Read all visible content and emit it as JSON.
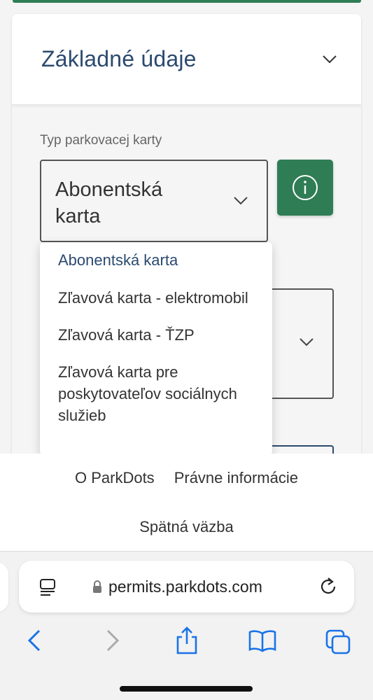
{
  "section": {
    "title": "Základné údaje"
  },
  "form": {
    "card_type_label": "Typ parkovacej karty",
    "card_type_value": "Abonentská karta"
  },
  "dropdown": {
    "options": [
      {
        "label": "Abonentská karta",
        "selected": true
      },
      {
        "label": "Zľavová karta - elektromobil",
        "selected": false
      },
      {
        "label": "Zľavová karta - ŤZP",
        "selected": false
      },
      {
        "label": "Zľavová karta pre poskytovateľov sociálnych služieb",
        "selected": false
      }
    ]
  },
  "footer": {
    "about": "O ParkDots",
    "legal": "Právne informácie",
    "feedback": "Spätná väzba"
  },
  "browser": {
    "url": "permits.parkdots.com"
  },
  "colors": {
    "brand_green": "#2f7d55",
    "title_blue": "#2b4a6f",
    "ios_blue": "#1a73e8"
  }
}
